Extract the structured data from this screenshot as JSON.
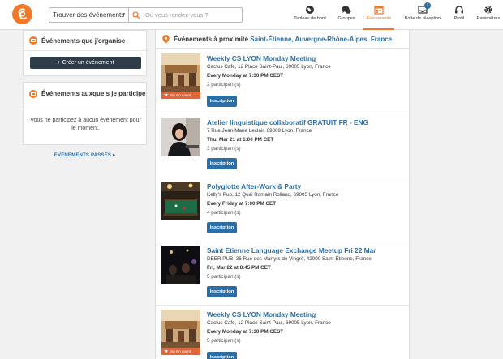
{
  "header": {
    "find_dropdown": "Trouver des événements",
    "search_placeholder": "Où vous rendez-vous ?",
    "nav": [
      {
        "label": "Tableau de bord",
        "icon": "globe-icon"
      },
      {
        "label": "Groupes",
        "icon": "chat-bubbles-icon"
      },
      {
        "label": "Événements",
        "icon": "calendar-icon",
        "active": true
      },
      {
        "label": "Boîte de réception",
        "icon": "inbox-icon",
        "badge": "1"
      },
      {
        "label": "Profil",
        "icon": "headset-icon"
      },
      {
        "label": "Paramètres",
        "icon": "gear-icon"
      }
    ],
    "accent": "#f07a2a"
  },
  "sidebar": {
    "organize_title": "Événements que j'organise",
    "create_button": "+ Créer un événement",
    "participate_title": "Événements auxquels je participe",
    "empty_message": "Vous ne participez à aucun événement pour le moment.",
    "past_link": "ÉVÉNEMENTS PASSÉS"
  },
  "main": {
    "title_prefix": "Événements à proximité",
    "location": "Saint-Étienne, Auvergne-Rhône-Alpes, France",
    "featured_label": "Mis En Avant",
    "register_label": "Inscription",
    "events": [
      {
        "title": "Weekly CS LYON Monday Meeting",
        "address": "Cactus Café, 12 Place Saint-Paul, 69005 Lyon, France",
        "time": "Every Monday at 7:30 PM CEST",
        "participants": "2 participant(s)",
        "featured": true
      },
      {
        "title": "Atelier linguistique collaboratif GRATUIT FR - ENG",
        "address": "7 Rue Jean-Marie Leclair, 69009 Lyon, France",
        "time": "Thu, Mar 21 at 6:00 PM CET",
        "participants": "3 participant(s)",
        "featured": false
      },
      {
        "title": "Polyglotte After-Work & Party",
        "address": "Kelly's Pub, 12 Quai Romain Rolland, 69005 Lyon, France",
        "time": "Every Friday at 7:00 PM CET",
        "participants": "4 participant(s)",
        "featured": false
      },
      {
        "title": "Saint Etienne Language Exchange Meetup Fri 22 Mar",
        "address": "DEER PUB, 36 Rue des Martyrs de Vingré, 42000 Saint-Étienne, France",
        "time": "Fri, Mar 22 at 8:45 PM CET",
        "participants": "5 participant(s)",
        "featured": false
      },
      {
        "title": "Weekly CS LYON Monday Meeting",
        "address": "Cactus Café, 12 Place Saint-Paul, 69005 Lyon, France",
        "time": "Every Monday at 7:30 PM CEST",
        "participants": "5 participant(s)",
        "featured": true
      }
    ]
  }
}
